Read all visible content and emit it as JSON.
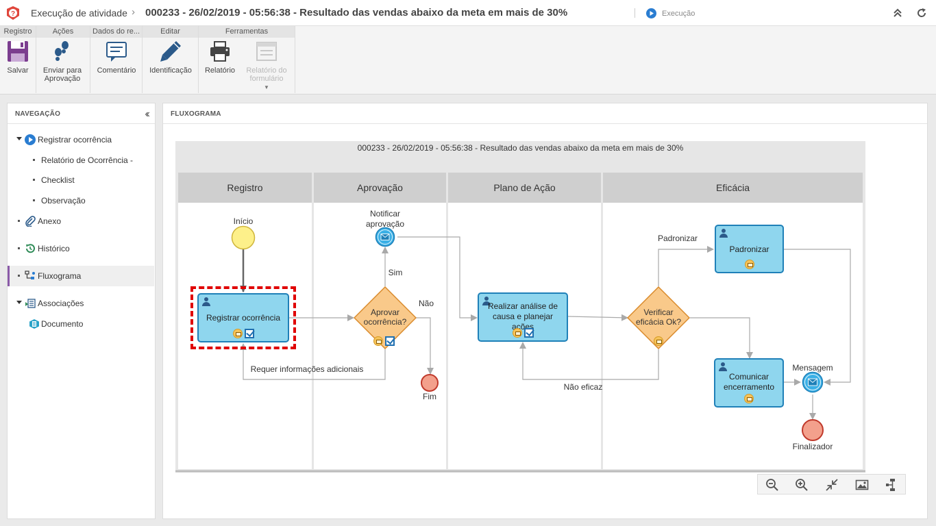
{
  "header": {
    "app_title": "Execução de atividade",
    "record_title": "000233 - 26/02/2019 - 05:56:38 - Resultado das vendas abaixo da meta em mais de 30%",
    "status_label": "Execução",
    "icons": [
      "alert-shield-icon",
      "play-icon",
      "collapse-up-icon",
      "refresh-icon"
    ]
  },
  "ribbon": {
    "groups": [
      {
        "label": "Registro"
      },
      {
        "label": "Ações"
      },
      {
        "label": "Dados do re..."
      },
      {
        "label": "Editar"
      },
      {
        "label": "Ferramentas"
      }
    ],
    "buttons": {
      "save": "Salvar",
      "send_line1": "Enviar para",
      "send_line2": "Aprovação",
      "comment": "Comentário",
      "identification": "Identificação",
      "report": "Relatório",
      "form_report_line1": "Relatório do",
      "form_report_line2": "formulário"
    }
  },
  "navigation": {
    "title": "NAVEGAÇÃO",
    "items": [
      {
        "label": "Registrar ocorrência"
      },
      {
        "label": "Relatório de Ocorrência -"
      },
      {
        "label": "Checklist"
      },
      {
        "label": "Observação"
      },
      {
        "label": "Anexo"
      },
      {
        "label": "Histórico"
      },
      {
        "label": "Fluxograma"
      },
      {
        "label": "Associações"
      },
      {
        "label": "Documento"
      }
    ]
  },
  "flowchart": {
    "panel_title": "FLUXOGRAMA",
    "diagram_title": "000233 - 26/02/2019 - 05:56:38 - Resultado das vendas abaixo da meta em mais de 30%",
    "lanes": [
      "Registro",
      "Aprovação",
      "Plano de Ação",
      "Eficácia"
    ],
    "nodes": {
      "inicio": "Início",
      "registrar": "Registrar ocorrência",
      "notificar": "Notificar aprovação",
      "aprovar": "Aprovar ocorrência?",
      "fim": "Fim",
      "realizar": "Realizar análise de causa e planejar ações",
      "verificar": "Verificar eficácia Ok?",
      "padronizar": "Padronizar",
      "comunicar": "Comunicar encerramento",
      "mensagem": "Mensagem",
      "finalizador": "Finalizador"
    },
    "edges": {
      "sim": "Sim",
      "nao": "Não",
      "requer": "Requer informações adicionais",
      "padronizar": "Padronizar",
      "nao_eficaz": "Não eficaz"
    },
    "colors": {
      "task_fill": "#8fd6ee",
      "task_border": "#1f80b8",
      "gateway_fill": "#f9c98a",
      "gateway_border": "#d98a2b",
      "start_fill": "#fdf08a",
      "end_fill": "#f3a08c",
      "selection": "#e00000"
    }
  },
  "zoom_toolbar": {
    "icons": [
      "zoom-out-icon",
      "zoom-in-icon",
      "fit-screen-icon",
      "export-image-icon",
      "layout-icon"
    ]
  }
}
